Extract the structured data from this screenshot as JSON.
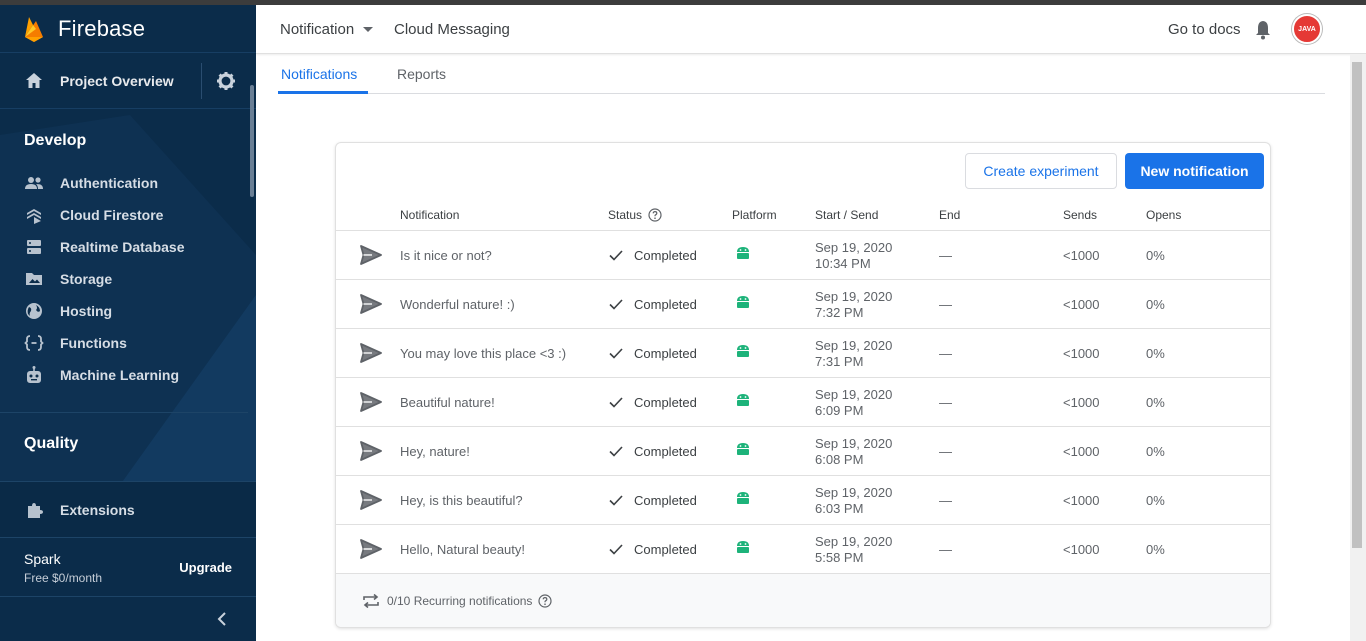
{
  "colors": {
    "sidebar_bg": "#0b2c4a",
    "accent": "#1a73e8",
    "android_green": "#1db37a"
  },
  "sidebar": {
    "brand": "Firebase",
    "project_overview": "Project Overview",
    "develop_title": "Develop",
    "develop_items": [
      {
        "label": "Authentication",
        "icon": "people-icon"
      },
      {
        "label": "Cloud Firestore",
        "icon": "firestore-icon"
      },
      {
        "label": "Realtime Database",
        "icon": "database-icon"
      },
      {
        "label": "Storage",
        "icon": "storage-icon"
      },
      {
        "label": "Hosting",
        "icon": "globe-icon"
      },
      {
        "label": "Functions",
        "icon": "functions-icon"
      },
      {
        "label": "Machine Learning",
        "icon": "robot-icon"
      }
    ],
    "quality_title": "Quality",
    "extensions": "Extensions",
    "plan_name": "Spark",
    "plan_price": "Free $0/month",
    "upgrade": "Upgrade"
  },
  "header": {
    "product": "Notification",
    "page": "Cloud Messaging",
    "docs": "Go to docs",
    "avatar_text": "JAVA"
  },
  "tabs": [
    {
      "label": "Notifications",
      "active": true
    },
    {
      "label": "Reports",
      "active": false
    }
  ],
  "card": {
    "create_experiment": "Create experiment",
    "new_notification": "New notification",
    "columns": {
      "notification": "Notification",
      "status": "Status",
      "platform": "Platform",
      "start_send": "Start / Send",
      "end": "End",
      "sends": "Sends",
      "opens": "Opens"
    },
    "rows": [
      {
        "name": "Is it nice or not?",
        "status": "Completed",
        "date": "Sep 19, 2020",
        "time": "10:34 PM",
        "end": "—",
        "sends": "<1000",
        "opens": "0%"
      },
      {
        "name": "Wonderful nature! :)",
        "status": "Completed",
        "date": "Sep 19, 2020",
        "time": "7:32 PM",
        "end": "—",
        "sends": "<1000",
        "opens": "0%"
      },
      {
        "name": "You may love this place <3 :)",
        "status": "Completed",
        "date": "Sep 19, 2020",
        "time": "7:31 PM",
        "end": "—",
        "sends": "<1000",
        "opens": "0%"
      },
      {
        "name": "Beautiful nature!",
        "status": "Completed",
        "date": "Sep 19, 2020",
        "time": "6:09 PM",
        "end": "—",
        "sends": "<1000",
        "opens": "0%"
      },
      {
        "name": "Hey, nature!",
        "status": "Completed",
        "date": "Sep 19, 2020",
        "time": "6:08 PM",
        "end": "—",
        "sends": "<1000",
        "opens": "0%"
      },
      {
        "name": "Hey, is this beautiful?",
        "status": "Completed",
        "date": "Sep 19, 2020",
        "time": "6:03 PM",
        "end": "—",
        "sends": "<1000",
        "opens": "0%"
      },
      {
        "name": "Hello, Natural beauty!",
        "status": "Completed",
        "date": "Sep 19, 2020",
        "time": "5:58 PM",
        "end": "—",
        "sends": "<1000",
        "opens": "0%"
      }
    ],
    "recurring": "0/10 Recurring notifications"
  }
}
